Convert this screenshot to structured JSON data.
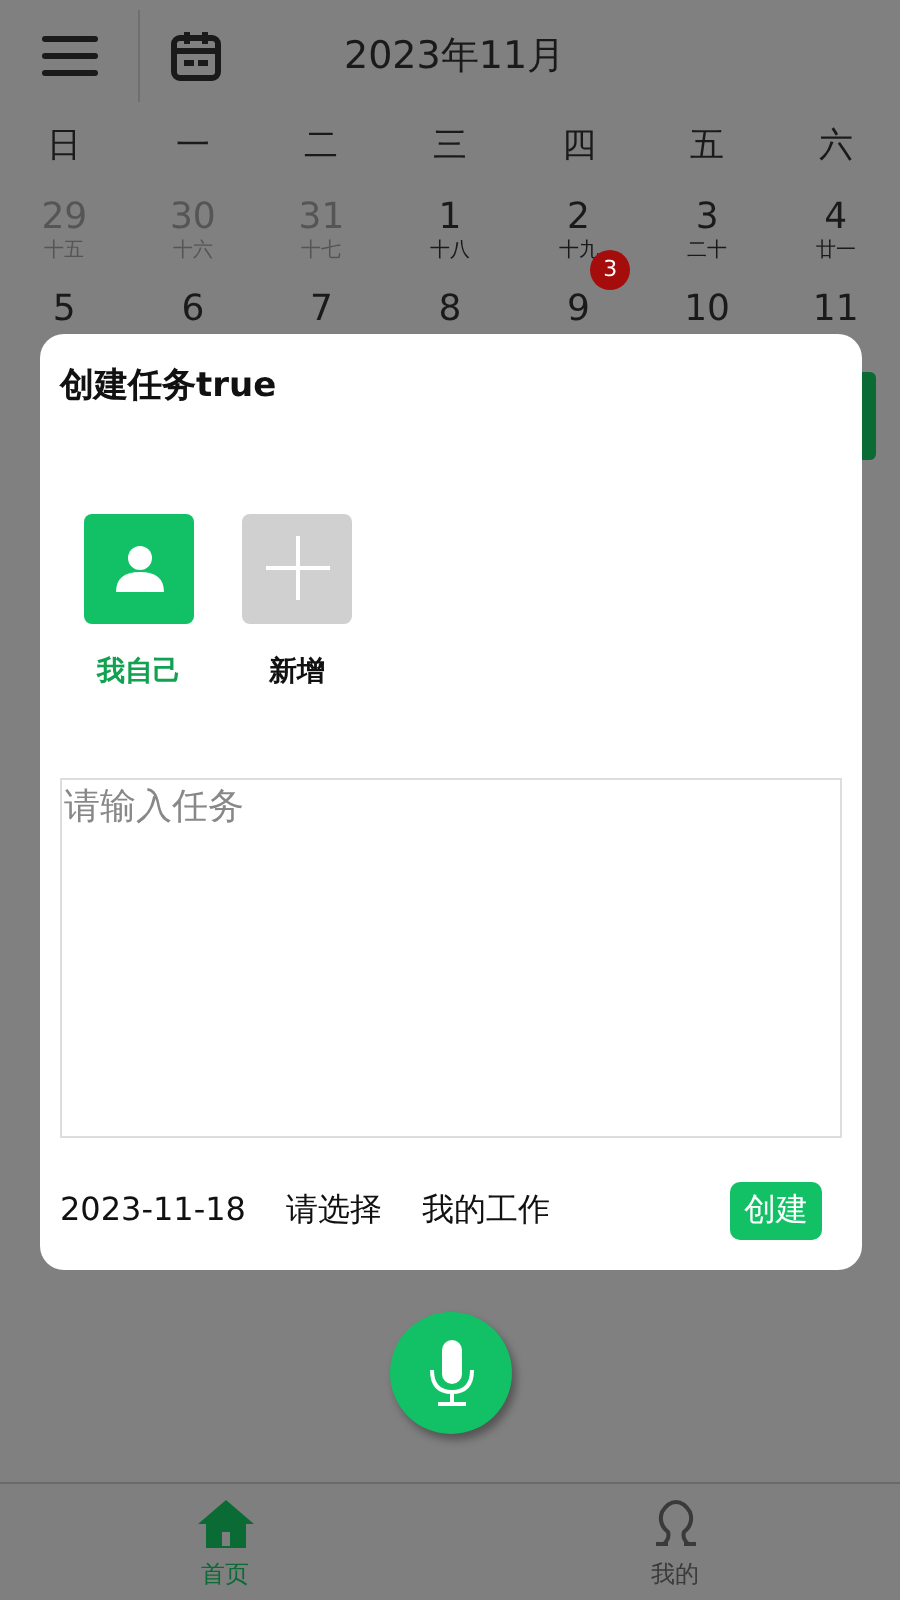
{
  "header": {
    "title": "2023年11月"
  },
  "weekdays": [
    "日",
    "一",
    "二",
    "三",
    "四",
    "五",
    "六"
  ],
  "weeks": [
    [
      {
        "day": "29",
        "lunar": "十五",
        "muted": true
      },
      {
        "day": "30",
        "lunar": "十六",
        "muted": true
      },
      {
        "day": "31",
        "lunar": "十七",
        "muted": true
      },
      {
        "day": "1",
        "lunar": "十八",
        "muted": false
      },
      {
        "day": "2",
        "lunar": "十九",
        "muted": false
      },
      {
        "day": "3",
        "lunar": "二十",
        "muted": false
      },
      {
        "day": "4",
        "lunar": "廿一",
        "muted": false
      }
    ],
    [
      {
        "day": "5",
        "muted": false
      },
      {
        "day": "6",
        "muted": false
      },
      {
        "day": "7",
        "muted": false
      },
      {
        "day": "8",
        "muted": false
      },
      {
        "day": "9",
        "muted": false,
        "badge": "3"
      },
      {
        "day": "10",
        "muted": false
      },
      {
        "day": "11",
        "muted": false
      }
    ]
  ],
  "modal": {
    "title": "创建任务true",
    "assignees": [
      {
        "label": "我自己",
        "kind": "person",
        "selected": true
      },
      {
        "label": "新增",
        "kind": "add",
        "selected": false
      }
    ],
    "task_field": {
      "placeholder": "请输入任务"
    },
    "date": "2023-11-18",
    "picker": "请选择",
    "category": "我的工作",
    "create_button": "创建"
  },
  "tabs": [
    {
      "label": "首页",
      "kind": "home",
      "selected": true
    },
    {
      "label": "我的",
      "kind": "profile",
      "selected": false
    }
  ]
}
